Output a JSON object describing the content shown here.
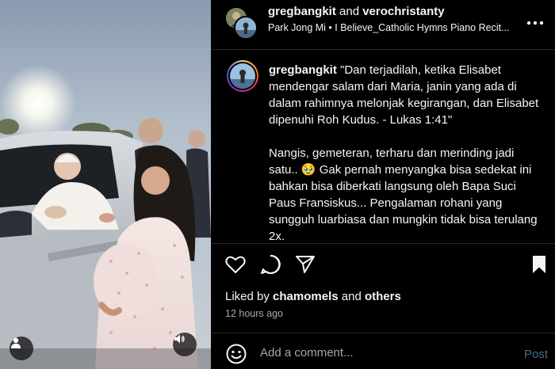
{
  "media": {
    "icons": [
      "user-tag-icon",
      "volume-icon"
    ]
  },
  "header": {
    "user1": "gregbangkit",
    "and_text": "and",
    "user2": "verochristanty",
    "music": "Park Jong Mi • I Believe_Catholic Hymns Piano Recit...",
    "more_icon": "more-horizontal-icon"
  },
  "caption": {
    "username": "gregbangkit",
    "para1": "\"Dan terjadilah, ketika Elisabet mendengar salam dari Maria, janin yang ada di dalam rahimnya melonjak kegirangan, dan Elisabet dipenuhi Roh Kudus. - Lukas 1:41\"",
    "para2": "Nangis, gemeteran, terharu dan merinding jadi satu.. 🥹 Gak pernah menyangka bisa sedekat ini bahkan bisa diberkati langsung oleh Bapa Suci Paus Fransiskus... Pengalaman rohani yang sungguh luarbiasa dan mungkin tidak bisa terulang 2x."
  },
  "actions": {
    "icons": [
      "heart-icon",
      "comment-icon",
      "share-icon",
      "bookmark-icon"
    ]
  },
  "likes": {
    "prefix": "Liked by",
    "user": "chamomels",
    "and_text": "and",
    "others": "others"
  },
  "timestamp": "12 hours ago",
  "comment": {
    "placeholder": "Add a comment...",
    "post_label": "Post"
  },
  "colors": {
    "background": "#000000",
    "text": "#f5f5f5",
    "muted": "#a8a8a8",
    "post_disabled": "#3f6f95"
  }
}
